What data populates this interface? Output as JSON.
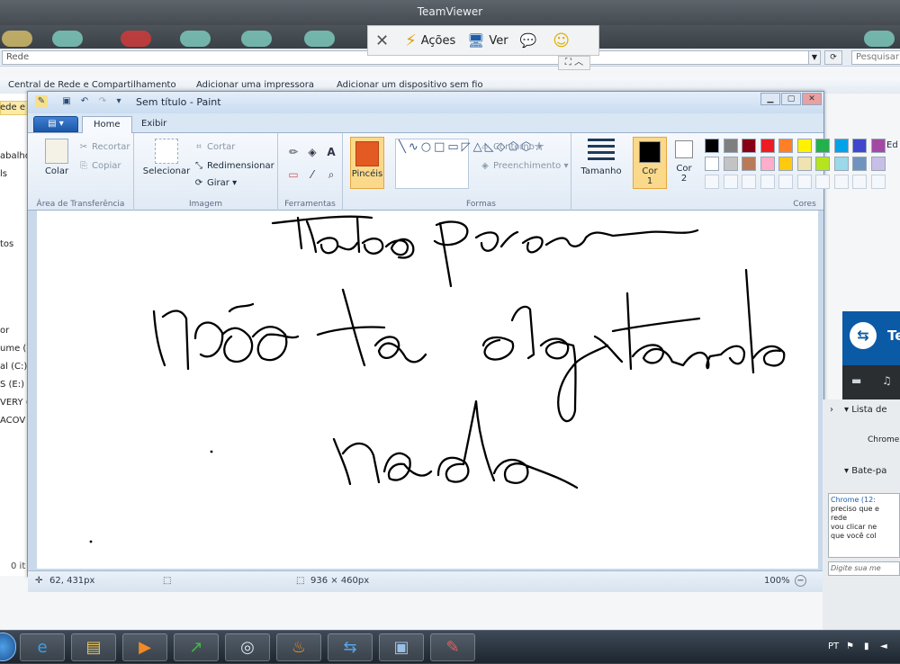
{
  "teamviewer": {
    "window_title": "TeamViewer",
    "toolbar": {
      "close": "✕",
      "actions": "Ações",
      "view": "Ver",
      "actions_icon": "⚡",
      "view_icon": "🖥",
      "chat_icon": "💬",
      "emoji_icon": "☺"
    },
    "sub_toggle": "⛶ ︿",
    "side_panel": {
      "title": "Te",
      "partner_list": "Lista de",
      "partner_item": "Chrome",
      "chat_header": "Bate-pa",
      "chat_lines": [
        "Chrome (12:",
        "preciso que e",
        "rede",
        "vou clicar ne",
        "que você col"
      ],
      "chat_input_placeholder": "Digite sua me"
    }
  },
  "explorer_bg": {
    "address": "Rede",
    "search_placeholder": "Pesquisar",
    "commands": [
      "Central de Rede e Compartilhamento",
      "Adicionar uma impressora",
      "Adicionar um dispositivo sem fio"
    ],
    "left_pane": [
      "ede e c",
      "abalho",
      "ls",
      "tos",
      "or",
      "ume (B",
      "al (C:)",
      "S (E:)",
      "VERY (",
      "ACOV"
    ],
    "status": "0 it"
  },
  "paint": {
    "title": "Sem título - Paint",
    "tabs": {
      "file": "▤ ▾",
      "home": "Home",
      "view": "Exibir"
    },
    "clipboard": {
      "paste": "Colar",
      "cut": "Recortar",
      "copy": "Copiar",
      "label": "Área de Transferência"
    },
    "image": {
      "select": "Selecionar",
      "crop": "Cortar",
      "resize": "Redimensionar",
      "rotate": "Girar",
      "label": "Imagem"
    },
    "tools": {
      "label": "Ferramentas",
      "pencil": "✏",
      "fill": "◈",
      "text": "A",
      "eraser": "▭",
      "picker": "⁄",
      "zoom": "⌕"
    },
    "brushes": "Pincéis",
    "shapes": {
      "outline": "Contorno",
      "fill": "Preenchimento",
      "label": "Formas",
      "glyphs": "╲∿○□▭◸△◺◇⬠⬡☆"
    },
    "size": "Tamanho",
    "color1": "Cor 1",
    "color2": "Cor 2",
    "colors_label": "Cores",
    "palette": [
      "#000000",
      "#7f7f7f",
      "#880015",
      "#ed1c24",
      "#ff7f27",
      "#fff200",
      "#22b14c",
      "#00a2e8",
      "#3f48cc",
      "#a349a4",
      "#ffffff",
      "#c3c3c3",
      "#b97a57",
      "#ffaec9",
      "#ffc90e",
      "#efe4b0",
      "#b5e61d",
      "#99d9ea",
      "#7092be",
      "#c8bfe7"
    ],
    "edit_colors": "Ed co",
    "status": {
      "cursor_pos": "62, 431px",
      "canvas_size": "936 × 460px",
      "zoom": "100%"
    }
  },
  "taskbar": {
    "apps": [
      {
        "name": "internet-explorer",
        "glyph": "e",
        "color": "#3aa0e8"
      },
      {
        "name": "file-explorer",
        "glyph": "▤",
        "color": "#e8c257"
      },
      {
        "name": "media-player",
        "glyph": "▶",
        "color": "#f08a24"
      },
      {
        "name": "stocks-app",
        "glyph": "↗",
        "color": "#3bbf3b"
      },
      {
        "name": "network-app",
        "glyph": "◎",
        "color": "#d8e4f0"
      },
      {
        "name": "flame-app",
        "glyph": "♨",
        "color": "#f08a24"
      },
      {
        "name": "teamviewer-app",
        "glyph": "⇆",
        "color": "#57a6f0"
      },
      {
        "name": "remote-app",
        "glyph": "▣",
        "color": "#9ac0e8"
      },
      {
        "name": "paint-app",
        "glyph": "✎",
        "color": "#e06060"
      }
    ],
    "tray_lang": "PT"
  }
}
